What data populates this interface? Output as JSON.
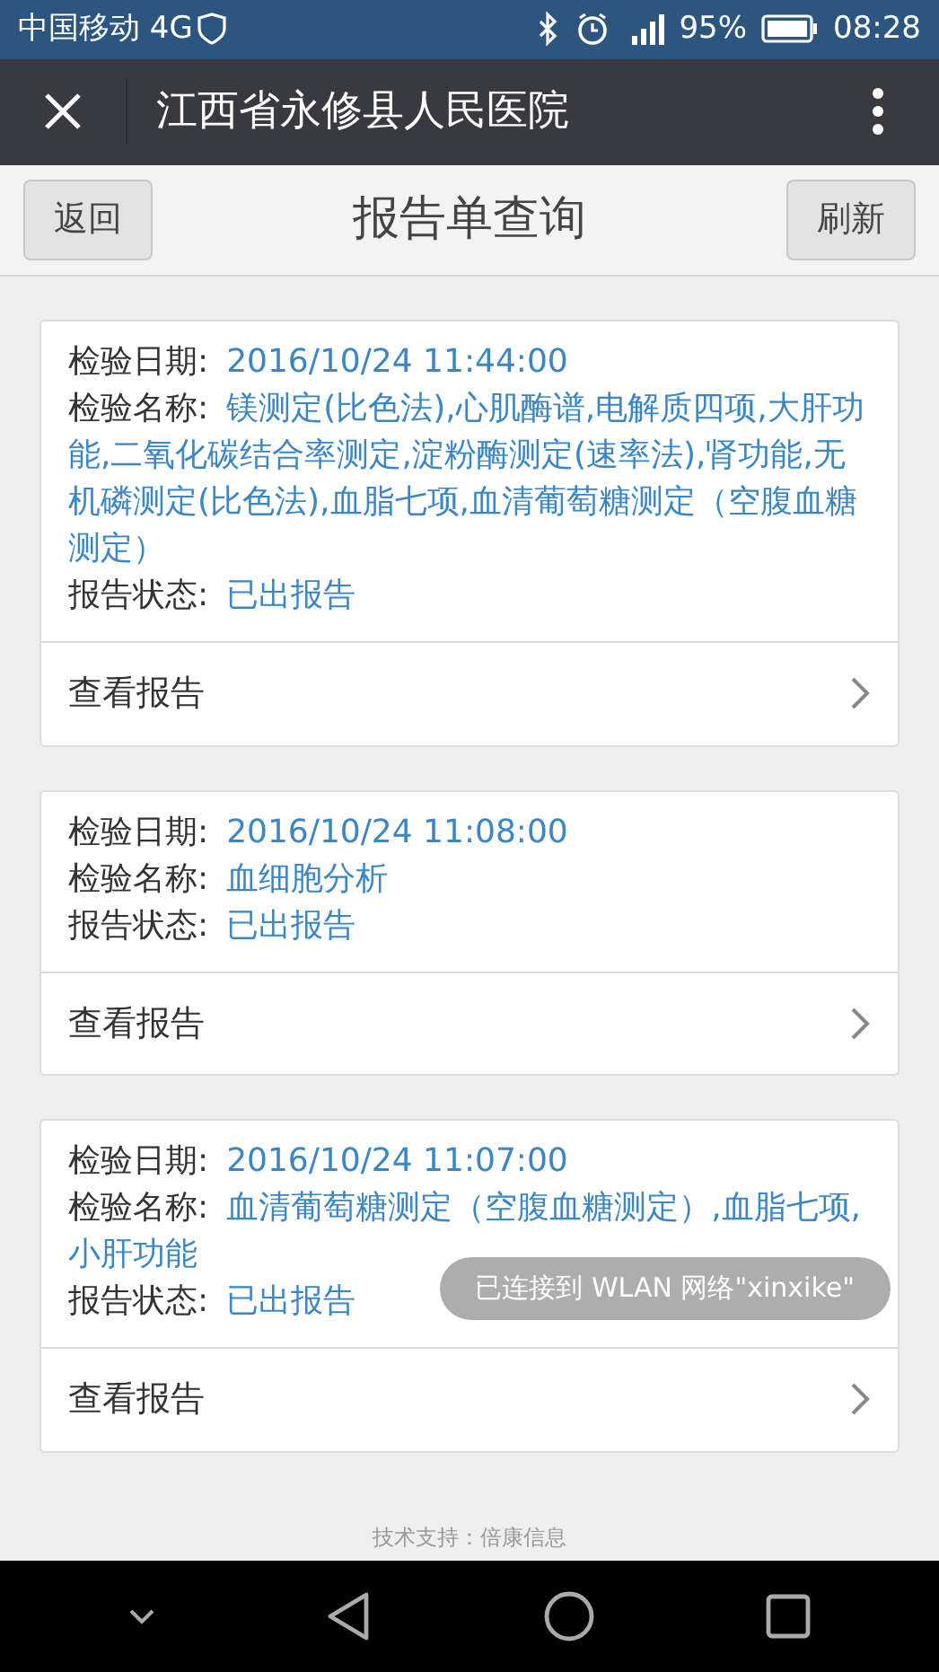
{
  "status_bar": {
    "carrier": "中国移动 4G",
    "battery": "95%",
    "time": "08:28"
  },
  "nav_bar": {
    "title": "江西省永修县人民医院"
  },
  "header": {
    "back": "返回",
    "title": "报告单查询",
    "refresh": "刷新"
  },
  "reports": [
    {
      "date_label": "检验日期:",
      "date": "2016/10/24 11:44:00",
      "name_label": "检验名称:",
      "name": "镁测定(比色法),心肌酶谱,电解质四项,大肝功能,二氧化碳结合率测定,淀粉酶测定(速率法),肾功能,无机磷测定(比色法),血脂七项,血清葡萄糖测定（空腹血糖测定）",
      "status_label": "报告状态:",
      "status": "已出报告",
      "action": "查看报告"
    },
    {
      "date_label": "检验日期:",
      "date": "2016/10/24 11:08:00",
      "name_label": "检验名称:",
      "name": "血细胞分析",
      "status_label": "报告状态:",
      "status": "已出报告",
      "action": "查看报告"
    },
    {
      "date_label": "检验日期:",
      "date": "2016/10/24 11:07:00",
      "name_label": "检验名称:",
      "name": "血清葡萄糖测定（空腹血糖测定）,血脂七项,小肝功能",
      "status_label": "报告状态:",
      "status": "已出报告",
      "action": "查看报告"
    }
  ],
  "toast": "已连接到 WLAN 网络\"xinxike\"",
  "footer": "技术支持：倍康信息"
}
